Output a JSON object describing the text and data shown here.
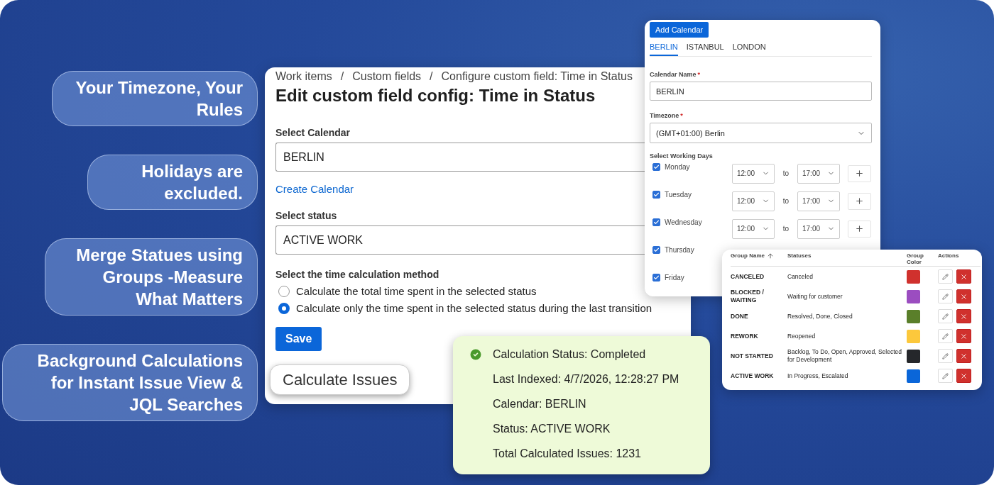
{
  "callouts": [
    {
      "text": "Your Timezone, Your Rules"
    },
    {
      "text": "Holidays are excluded."
    },
    {
      "text": "Merge Statues using Groups -Measure What Matters"
    },
    {
      "text": "Background Calculations for Instant Issue View & JQL Searches"
    }
  ],
  "config_panel": {
    "breadcrumb": [
      "Work items",
      "Custom fields",
      "Configure custom field: Time in Status"
    ],
    "separators": [
      "/",
      "/"
    ],
    "title": "Edit custom field config: Time in Status",
    "calendar_label": "Select Calendar",
    "calendar_value": "BERLIN",
    "create_link": "Create Calendar",
    "status_label": "Select status",
    "status_value": "ACTIVE WORK",
    "method_label": "Select the time calculation method",
    "methods": [
      {
        "label": "Calculate the total time spent in the selected status",
        "selected": false
      },
      {
        "label": "Calculate only the time spent in the selected status during the last transition",
        "selected": true
      }
    ],
    "save_button": "Save"
  },
  "calculate_button": "Calculate Issues",
  "calendar_panel": {
    "add_button": "Add Calendar",
    "tabs": [
      {
        "label": "BERLIN",
        "selected": true
      },
      {
        "label": "ISTANBUL",
        "selected": false
      },
      {
        "label": "LONDON",
        "selected": false
      }
    ],
    "name_label": "Calendar Name",
    "name_required": "*",
    "name_value": "BERLIN",
    "timezone_label": "Timezone",
    "timezone_required": "*",
    "timezone_value": "(GMT+01:00) Berlin",
    "days_label": "Select Working Days",
    "days": [
      {
        "kind": "timed",
        "label": "Monday",
        "checked": true,
        "start": "12:00",
        "to": "to",
        "end": "17:00"
      },
      {
        "kind": "timed",
        "label": "Tuesday",
        "checked": true,
        "start": "12:00",
        "to": "to",
        "end": "17:00"
      },
      {
        "kind": "timed",
        "label": "Wednesday",
        "checked": true,
        "start": "12:00",
        "to": "to",
        "end": "17:00"
      },
      {
        "kind": "plain",
        "label": "Thursday",
        "checked": true
      },
      {
        "kind": "plain",
        "label": "Friday",
        "checked": true
      }
    ]
  },
  "status_card": {
    "lines": [
      "Calculation Status: Completed",
      "Last Indexed: 4/7/2026, 12:28:27 PM",
      "Calendar: BERLIN",
      "Status: ACTIVE WORK",
      "Total Calculated Issues: 1231"
    ]
  },
  "groups_table": {
    "columns": [
      {
        "label": "Group Name",
        "sorted": true
      },
      {
        "label": "Statuses",
        "sorted": false
      },
      {
        "label": "Group Color",
        "sorted": false
      },
      {
        "label": "Actions",
        "sorted": false
      }
    ],
    "rows": [
      {
        "name": "CANCELED",
        "statuses": "Canceled",
        "color": "#d0312d"
      },
      {
        "name": "BLOCKED / WAITING",
        "statuses": "Waiting for customer",
        "color": "#9b4dc0"
      },
      {
        "name": "DONE",
        "statuses": "Resolved, Done, Closed",
        "color": "#5a7f2a"
      },
      {
        "name": "REWORK",
        "statuses": "Reopened",
        "color": "#fcc83c"
      },
      {
        "name": "NOT STARTED",
        "statuses": "Backlog, To Do, Open, Approved, Selected for Development",
        "color": "#25272b"
      },
      {
        "name": "ACTIVE WORK",
        "statuses": "In Progress, Escalated",
        "color": "#0a66d9"
      }
    ]
  }
}
